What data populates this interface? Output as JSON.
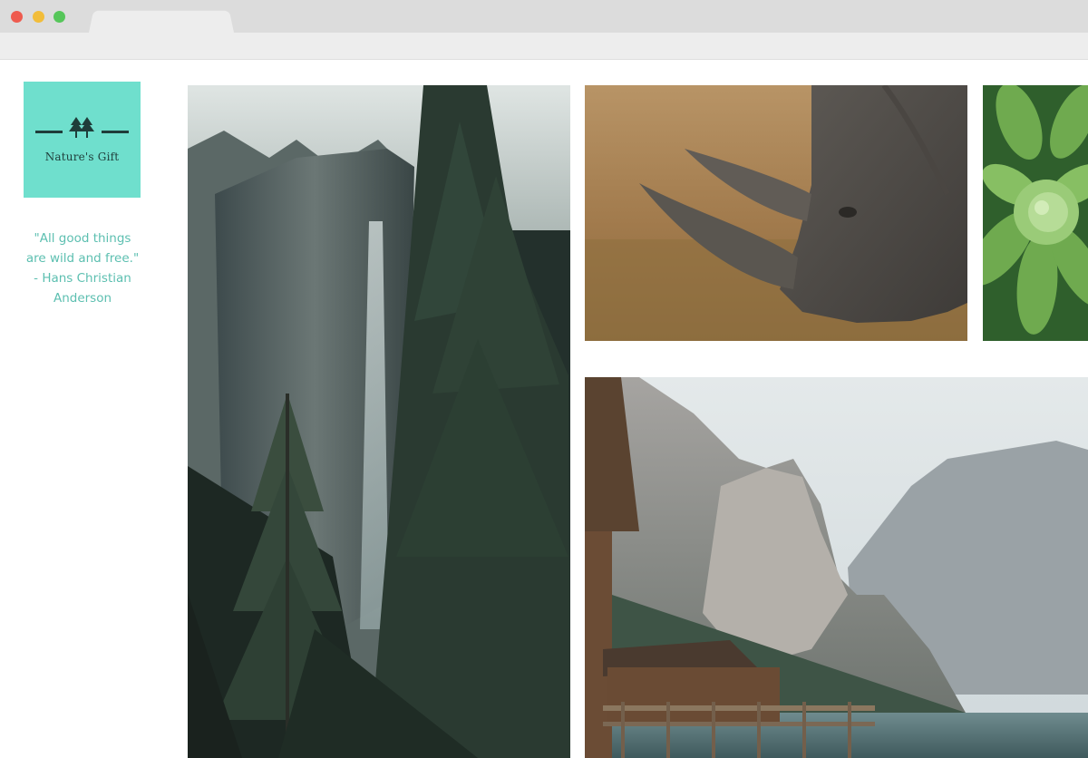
{
  "brand": {
    "name": "Nature's Gift",
    "color": "#6fdfcd",
    "icon": "trees-icon"
  },
  "quote": {
    "lines": [
      "\"All good things",
      "are wild and free.\"",
      "- Hans Christian",
      "Anderson"
    ],
    "color": "#5cbfb0"
  },
  "gallery": [
    {
      "name": "forest-waterfall-photo"
    },
    {
      "name": "rhino-photo"
    },
    {
      "name": "succulent-photo"
    },
    {
      "name": "mountain-lake-photo"
    }
  ]
}
